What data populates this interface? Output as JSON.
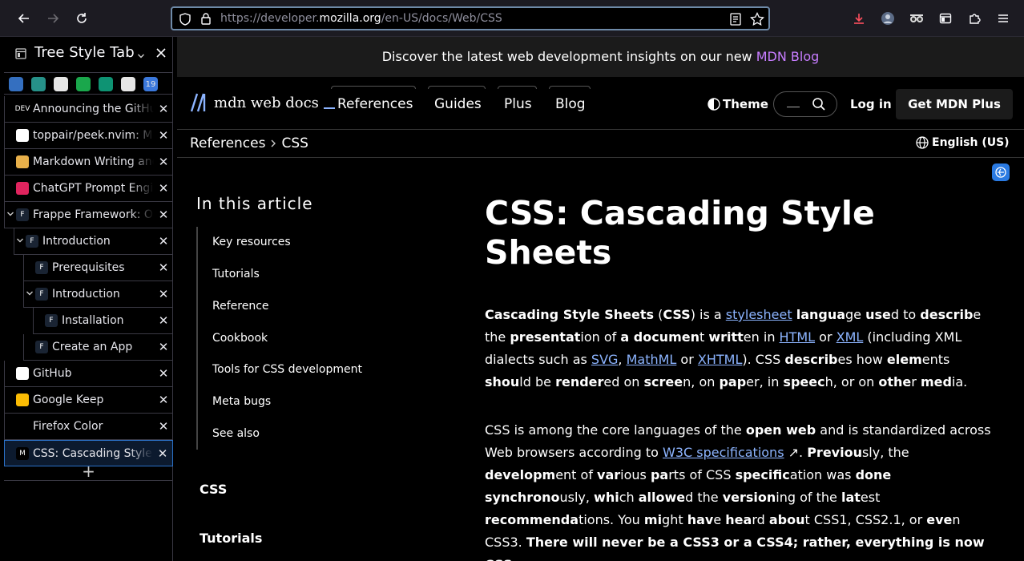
{
  "browser": {
    "url_scheme": "https://developer.",
    "url_host": "mozilla.org",
    "url_path": "/en-US/docs/Web/CSS"
  },
  "sidebar": {
    "title": "Tree Style Tab",
    "pinned": [
      {
        "icon": "diamond-icon",
        "color": "#3a7bd5"
      },
      {
        "icon": "chart-icon",
        "color": "#2aa198"
      },
      {
        "icon": "circle-arrow-icon",
        "color": "#ffffff"
      },
      {
        "icon": "spotify-icon",
        "color": "#1db954"
      },
      {
        "icon": "openai-icon",
        "color": "#10a37f"
      },
      {
        "icon": "github-icon",
        "color": "#ffffff"
      },
      {
        "icon": "calendar-icon",
        "color": "#4285f4",
        "text": "19"
      }
    ],
    "tabs": [
      {
        "label": "Announcing the GitHub",
        "fav": "DEV",
        "fav_bg": "#000",
        "indent": 0
      },
      {
        "label": "toppair/peek.nvim: M",
        "fav": "",
        "fav_bg": "#fff",
        "indent": 0
      },
      {
        "label": "Markdown Writing and",
        "fav": "",
        "fav_bg": "#e8b04a",
        "indent": 0
      },
      {
        "label": "ChatGPT Prompt Engi",
        "fav": "",
        "fav_bg": "#e0245e",
        "indent": 0
      },
      {
        "label": "Frappe Framework: O",
        "fav": "F",
        "fav_bg": "#1a2433",
        "indent": 0,
        "twisty": "⌄"
      },
      {
        "label": "Introduction",
        "fav": "F",
        "fav_bg": "#1a2433",
        "indent": 1,
        "twisty": "⌄"
      },
      {
        "label": "Prerequisites",
        "fav": "F",
        "fav_bg": "#1a2433",
        "indent": 2
      },
      {
        "label": "Introduction",
        "fav": "F",
        "fav_bg": "#1a2433",
        "indent": 2,
        "twisty": "⌄"
      },
      {
        "label": "Installation",
        "fav": "F",
        "fav_bg": "#1a2433",
        "indent": 3
      },
      {
        "label": "Create an App",
        "fav": "F",
        "fav_bg": "#1a2433",
        "indent": 2
      },
      {
        "label": "GitHub",
        "fav": "",
        "fav_bg": "#fff",
        "indent": 0
      },
      {
        "label": "Google Keep",
        "fav": "",
        "fav_bg": "#fbbc04",
        "indent": 0
      },
      {
        "label": "Firefox Color",
        "fav": "",
        "fav_bg": "#000",
        "indent": 0
      },
      {
        "label": "CSS: Cascading Style",
        "fav": "M",
        "fav_bg": "#000",
        "indent": 0,
        "active": true
      }
    ],
    "close_glyph": "✕",
    "new_tab_glyph": "+"
  },
  "page": {
    "banner_prefix": "Discover the latest web development insights on our new ",
    "banner_link": "MDN Blog",
    "logo_text": "mdn web docs",
    "nav": [
      "References",
      "Guides",
      "Plus",
      "Blog"
    ],
    "theme_label": "Theme",
    "login_label": "Log in",
    "get_plus_label": "Get MDN Plus",
    "breadcrumbs": [
      "References",
      "CSS"
    ],
    "language_label": "English (US)",
    "toc_title": "In this article",
    "toc_items": [
      "Key resources",
      "Tutorials",
      "Reference",
      "Cookbook",
      "Tools for CSS development",
      "Meta bugs",
      "See also"
    ],
    "sidebar_sections": [
      "CSS",
      "Tutorials"
    ],
    "title": "CSS: Cascading Style Sheets"
  }
}
